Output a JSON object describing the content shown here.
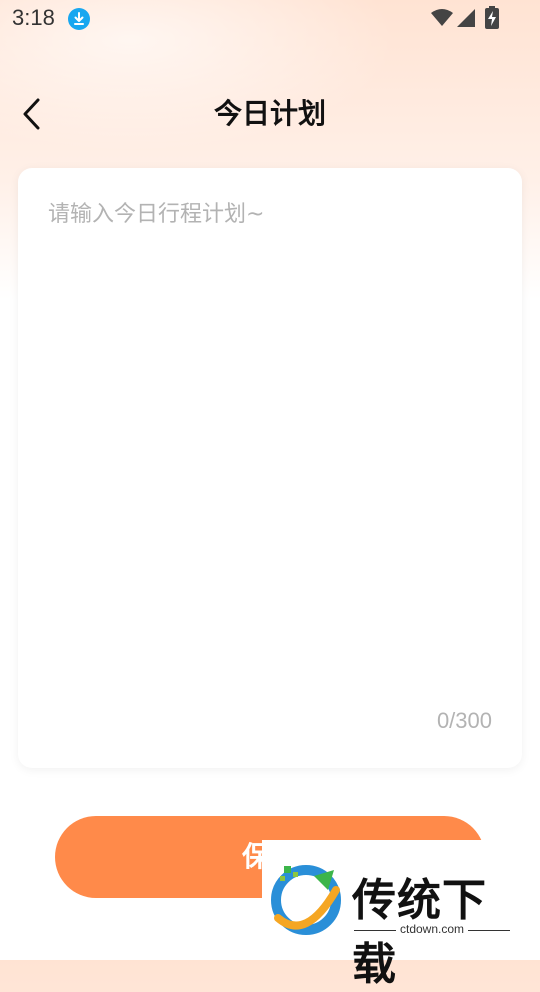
{
  "status_bar": {
    "time": "3:18",
    "download_icon": "download-icon",
    "wifi_icon": "wifi-icon",
    "signal_icon": "signal-icon",
    "battery_icon": "battery-charging-icon"
  },
  "header": {
    "back_icon": "chevron-left-icon",
    "title": "今日计划"
  },
  "plan_input": {
    "value": "",
    "placeholder": "请输入今日行程计划~",
    "counter": "0/300"
  },
  "save_button": {
    "label": "保存"
  },
  "watermark": {
    "brand": "传统下载",
    "url": "ctdown.com"
  },
  "colors": {
    "accent": "#ff8a4a",
    "background_top": "#ffe3d3",
    "placeholder": "#b3b3b3",
    "download_badge": "#18a7f0"
  }
}
